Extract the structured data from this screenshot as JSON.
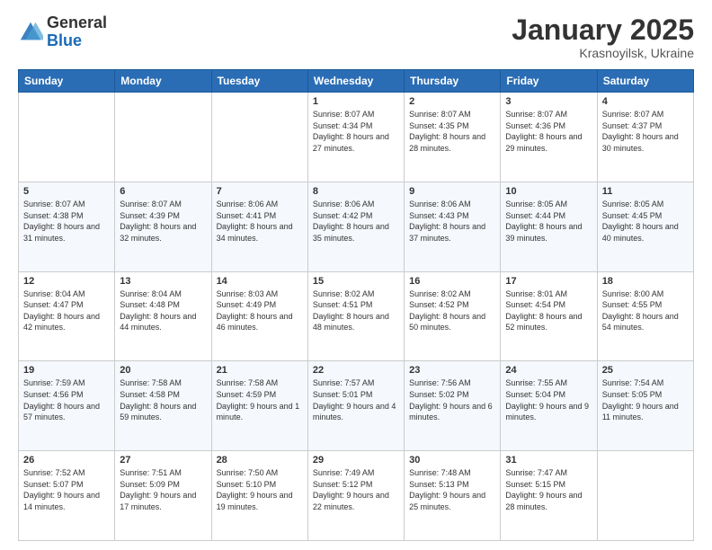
{
  "logo": {
    "general": "General",
    "blue": "Blue"
  },
  "header": {
    "month": "January 2025",
    "location": "Krasnoyilsk, Ukraine"
  },
  "weekdays": [
    "Sunday",
    "Monday",
    "Tuesday",
    "Wednesday",
    "Thursday",
    "Friday",
    "Saturday"
  ],
  "weeks": [
    [
      {
        "day": "",
        "info": ""
      },
      {
        "day": "",
        "info": ""
      },
      {
        "day": "",
        "info": ""
      },
      {
        "day": "1",
        "info": "Sunrise: 8:07 AM\nSunset: 4:34 PM\nDaylight: 8 hours and 27 minutes."
      },
      {
        "day": "2",
        "info": "Sunrise: 8:07 AM\nSunset: 4:35 PM\nDaylight: 8 hours and 28 minutes."
      },
      {
        "day": "3",
        "info": "Sunrise: 8:07 AM\nSunset: 4:36 PM\nDaylight: 8 hours and 29 minutes."
      },
      {
        "day": "4",
        "info": "Sunrise: 8:07 AM\nSunset: 4:37 PM\nDaylight: 8 hours and 30 minutes."
      }
    ],
    [
      {
        "day": "5",
        "info": "Sunrise: 8:07 AM\nSunset: 4:38 PM\nDaylight: 8 hours and 31 minutes."
      },
      {
        "day": "6",
        "info": "Sunrise: 8:07 AM\nSunset: 4:39 PM\nDaylight: 8 hours and 32 minutes."
      },
      {
        "day": "7",
        "info": "Sunrise: 8:06 AM\nSunset: 4:41 PM\nDaylight: 8 hours and 34 minutes."
      },
      {
        "day": "8",
        "info": "Sunrise: 8:06 AM\nSunset: 4:42 PM\nDaylight: 8 hours and 35 minutes."
      },
      {
        "day": "9",
        "info": "Sunrise: 8:06 AM\nSunset: 4:43 PM\nDaylight: 8 hours and 37 minutes."
      },
      {
        "day": "10",
        "info": "Sunrise: 8:05 AM\nSunset: 4:44 PM\nDaylight: 8 hours and 39 minutes."
      },
      {
        "day": "11",
        "info": "Sunrise: 8:05 AM\nSunset: 4:45 PM\nDaylight: 8 hours and 40 minutes."
      }
    ],
    [
      {
        "day": "12",
        "info": "Sunrise: 8:04 AM\nSunset: 4:47 PM\nDaylight: 8 hours and 42 minutes."
      },
      {
        "day": "13",
        "info": "Sunrise: 8:04 AM\nSunset: 4:48 PM\nDaylight: 8 hours and 44 minutes."
      },
      {
        "day": "14",
        "info": "Sunrise: 8:03 AM\nSunset: 4:49 PM\nDaylight: 8 hours and 46 minutes."
      },
      {
        "day": "15",
        "info": "Sunrise: 8:02 AM\nSunset: 4:51 PM\nDaylight: 8 hours and 48 minutes."
      },
      {
        "day": "16",
        "info": "Sunrise: 8:02 AM\nSunset: 4:52 PM\nDaylight: 8 hours and 50 minutes."
      },
      {
        "day": "17",
        "info": "Sunrise: 8:01 AM\nSunset: 4:54 PM\nDaylight: 8 hours and 52 minutes."
      },
      {
        "day": "18",
        "info": "Sunrise: 8:00 AM\nSunset: 4:55 PM\nDaylight: 8 hours and 54 minutes."
      }
    ],
    [
      {
        "day": "19",
        "info": "Sunrise: 7:59 AM\nSunset: 4:56 PM\nDaylight: 8 hours and 57 minutes."
      },
      {
        "day": "20",
        "info": "Sunrise: 7:58 AM\nSunset: 4:58 PM\nDaylight: 8 hours and 59 minutes."
      },
      {
        "day": "21",
        "info": "Sunrise: 7:58 AM\nSunset: 4:59 PM\nDaylight: 9 hours and 1 minute."
      },
      {
        "day": "22",
        "info": "Sunrise: 7:57 AM\nSunset: 5:01 PM\nDaylight: 9 hours and 4 minutes."
      },
      {
        "day": "23",
        "info": "Sunrise: 7:56 AM\nSunset: 5:02 PM\nDaylight: 9 hours and 6 minutes."
      },
      {
        "day": "24",
        "info": "Sunrise: 7:55 AM\nSunset: 5:04 PM\nDaylight: 9 hours and 9 minutes."
      },
      {
        "day": "25",
        "info": "Sunrise: 7:54 AM\nSunset: 5:05 PM\nDaylight: 9 hours and 11 minutes."
      }
    ],
    [
      {
        "day": "26",
        "info": "Sunrise: 7:52 AM\nSunset: 5:07 PM\nDaylight: 9 hours and 14 minutes."
      },
      {
        "day": "27",
        "info": "Sunrise: 7:51 AM\nSunset: 5:09 PM\nDaylight: 9 hours and 17 minutes."
      },
      {
        "day": "28",
        "info": "Sunrise: 7:50 AM\nSunset: 5:10 PM\nDaylight: 9 hours and 19 minutes."
      },
      {
        "day": "29",
        "info": "Sunrise: 7:49 AM\nSunset: 5:12 PM\nDaylight: 9 hours and 22 minutes."
      },
      {
        "day": "30",
        "info": "Sunrise: 7:48 AM\nSunset: 5:13 PM\nDaylight: 9 hours and 25 minutes."
      },
      {
        "day": "31",
        "info": "Sunrise: 7:47 AM\nSunset: 5:15 PM\nDaylight: 9 hours and 28 minutes."
      },
      {
        "day": "",
        "info": ""
      }
    ]
  ]
}
